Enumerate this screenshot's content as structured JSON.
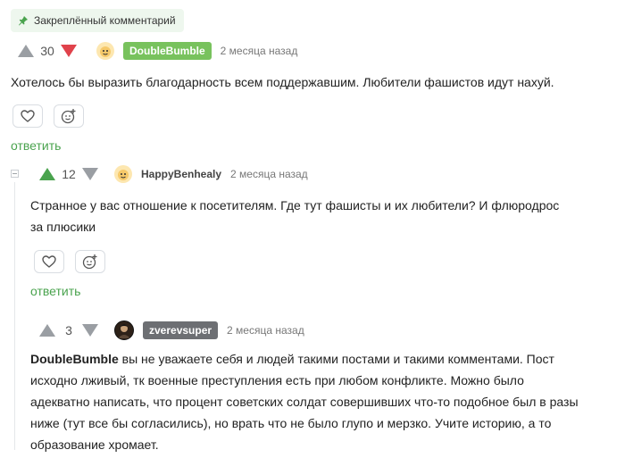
{
  "pinned_label": "Закреплённый комментарий",
  "comments": [
    {
      "score": "30",
      "author": "DoubleBumble",
      "author_color": "#78c25d",
      "time": "2 месяца назад",
      "text": "Хотелось бы выразить благодарность всем поддержавшим. Любители фашистов идут нахуй.",
      "reply_label": "ответить"
    },
    {
      "score": "12",
      "author": "HappyBenhealy",
      "time": "2 месяца назад",
      "text_line1": "Странное у вас отношение к посетителям. Где тут фашисты и их любители? И флюродрос",
      "text_line2": "за плюсики",
      "reply_label": "ответить"
    },
    {
      "score": "3",
      "author": "zverevsuper",
      "author_color": "#6d6f73",
      "time": "2 месяца назад",
      "mention": "DoubleBumble",
      "text_line1": " вы не уважаете себя и людей такими постами и такими комментами. Пост",
      "text_line2": "исходно лживый, тк военные преступления есть при любом конфликте. Можно было",
      "text_line3": "адекватно написать, что процент советских солдат совершивших что-то подобное был в разы",
      "text_line4": "ниже (тут все бы согласились), но врать что не было глупо и мерзко. Учите историю, а то",
      "text_line5": "образование хромает."
    }
  ],
  "icons": {
    "pin": "pin-icon",
    "like": "heart-icon",
    "reaction": "smiley-plus-icon",
    "collapse": "collapse-minus-icon"
  }
}
